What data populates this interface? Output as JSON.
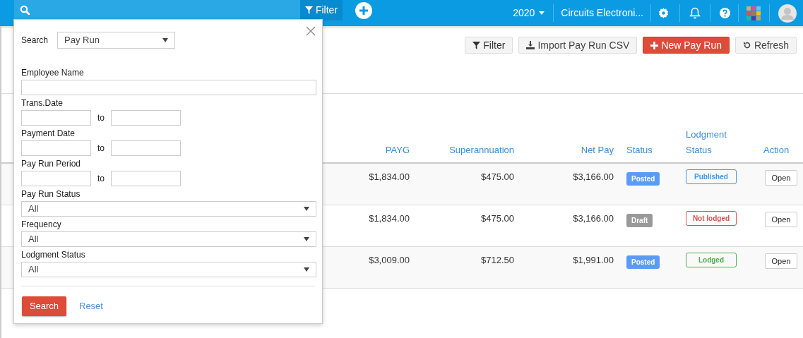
{
  "top_bar": {
    "filter_label": "Filter",
    "year": "2020",
    "company": "Circuits Electroni..."
  },
  "toolbar": {
    "buttons": [
      {
        "kind": "filter",
        "label": "Filter"
      },
      {
        "kind": "import",
        "label": "Import Pay Run CSV"
      },
      {
        "kind": "new",
        "label": "New Pay Run"
      },
      {
        "kind": "refresh",
        "label": "Refresh"
      }
    ]
  },
  "table": {
    "columns": [
      {
        "label": "PAYG"
      },
      {
        "label": "Superannuation"
      },
      {
        "label": "Net Pay"
      },
      {
        "label": "Status"
      },
      {
        "label": "Lodgment Status"
      },
      {
        "label": "Action"
      }
    ],
    "rows": [
      {
        "payg": "$1,834.00",
        "super": "$475.00",
        "net": "$3,166.00",
        "status": {
          "label": "Posted",
          "kind": "posted"
        },
        "lodgment": {
          "label": "Published",
          "kind": "published"
        },
        "action": "Open"
      },
      {
        "payg": "$1,834.00",
        "super": "$475.00",
        "net": "$3,166.00",
        "status": {
          "label": "Draft",
          "kind": "draft"
        },
        "lodgment": {
          "label": "Not lodged",
          "kind": "not_lodged"
        },
        "action": "Open"
      },
      {
        "payg": "$3,009.00",
        "super": "$712.50",
        "net": "$1,991.00",
        "status": {
          "label": "Posted",
          "kind": "posted"
        },
        "lodgment": {
          "label": "Lodged",
          "kind": "lodged"
        },
        "action": "Open"
      }
    ]
  },
  "filter_panel": {
    "search_label": "Search",
    "search_value": "Pay Run",
    "fields": [
      {
        "kind": "text",
        "label": "Employee Name"
      },
      {
        "kind": "range",
        "label": "Trans.Date",
        "separator": "to"
      },
      {
        "kind": "range",
        "label": "Payment Date",
        "separator": "to"
      },
      {
        "kind": "range",
        "label": "Pay Run Period",
        "separator": "to"
      },
      {
        "kind": "select",
        "label": "Pay Run Status",
        "value": "All"
      },
      {
        "kind": "select",
        "label": "Frequency",
        "value": "All"
      },
      {
        "kind": "select",
        "label": "Lodgment Status",
        "value": "All"
      }
    ],
    "search_button": "Search",
    "reset_link": "Reset"
  }
}
